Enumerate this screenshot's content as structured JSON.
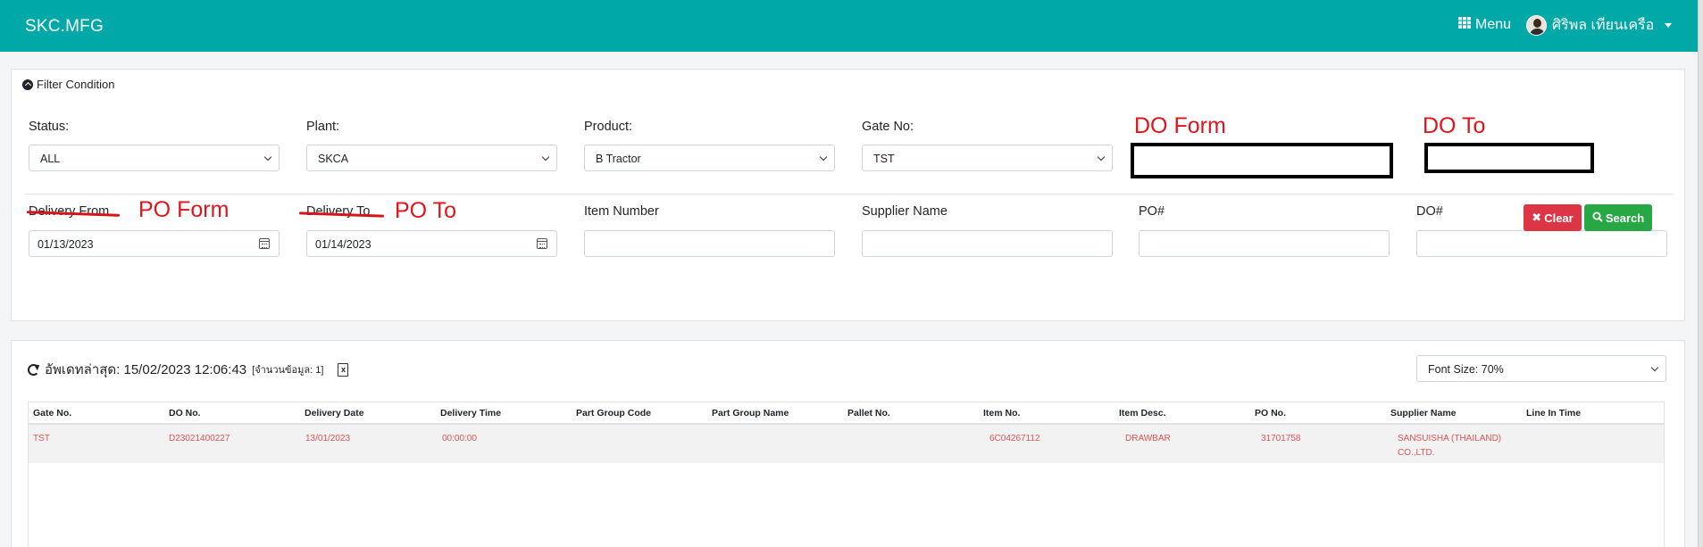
{
  "nav": {
    "brand": "SKC.MFG",
    "menu_label": "Menu",
    "user_name": "ศิริพล เทียนเครือ"
  },
  "filter": {
    "title": "Filter Condition",
    "status": {
      "label": "Status:",
      "value": "ALL"
    },
    "plant": {
      "label": "Plant:",
      "value": "SKCA"
    },
    "product": {
      "label": "Product:",
      "value": "B Tractor"
    },
    "gate": {
      "label": "Gate No:",
      "value": "TST"
    },
    "delivery_from": {
      "label": "Delivery From",
      "value": "01/13/2023"
    },
    "delivery_to": {
      "label": "Delivery To",
      "value": "01/14/2023"
    },
    "item_number": {
      "label": "Item Number",
      "value": ""
    },
    "supplier_name": {
      "label": "Supplier Name",
      "value": ""
    },
    "po": {
      "label": "PO#",
      "value": ""
    },
    "do": {
      "label": "DO#",
      "value": ""
    },
    "clear_label": "Clear",
    "search_label": "Search"
  },
  "annotations": {
    "do_form": "DO Form",
    "do_to": "DO To",
    "po_form": "PO Form",
    "po_to": "PO To",
    "color": "#e0141a"
  },
  "result": {
    "update_prefix": "อัพเดทล่าสุด: 15/02/2023 12:06:43",
    "record_count": "[จำนวนข้อมูล: 1]",
    "font_size": "Font Size: 70%",
    "columns": [
      "Gate No.",
      "DO No.",
      "Delivery Date",
      "Delivery Time",
      "Part Group Code",
      "Part Group Name",
      "Pallet No.",
      "Item No.",
      "Item Desc.",
      "PO No.",
      "Supplier Name",
      "Line In Time"
    ],
    "rows": [
      {
        "gate": "TST",
        "do_no": "D23021400227",
        "delivery_date": "13/01/2023",
        "delivery_time": "00:00:00",
        "part_group_code": "",
        "part_group_name": "",
        "pallet_no": "",
        "item_no": "6C04267112",
        "item_desc": "DRAWBAR",
        "po_no": "31701758",
        "supplier_1": "SANSUISHA (THAILAND)",
        "supplier_2": "CO.,LTD.",
        "line_in_time": ""
      }
    ]
  },
  "colors": {
    "navbar": "#00a8a8",
    "clear_button": "#dc3545",
    "search_button": "#28a745",
    "row_text": "#e05353"
  }
}
